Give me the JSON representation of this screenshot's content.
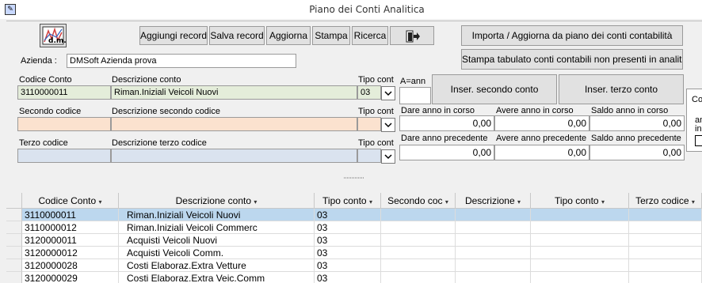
{
  "window": {
    "title": "Piano dei Conti Analitica"
  },
  "toolbar": {
    "add_record": "Aggiungi record",
    "save_record": "Salva record",
    "refresh": "Aggiorna",
    "print": "Stampa",
    "search": "Ricerca",
    "import": "Importa / Aggiorna da piano dei conti contabilità",
    "print_missing": "Stampa tabulato conti contabili non presenti in analitica",
    "logo_text": "d.m."
  },
  "company": {
    "label": "Azienda :",
    "value": "DMSoft Azienda prova"
  },
  "account": {
    "code_label": "Codice Conto",
    "desc_label": "Descrizione conto",
    "type_label": "Tipo cont",
    "code_value": "3110000011",
    "desc_value": "Riman.Iniziali Veicoli Nuovi",
    "type_value": "03"
  },
  "second": {
    "code_label": "Secondo codice",
    "desc_label": "Descrizione secondo codice",
    "type_label": "Tipo cont",
    "code_value": "",
    "desc_value": "",
    "type_value": ""
  },
  "third": {
    "code_label": "Terzo codice",
    "desc_label": "Descrizione terzo codice",
    "type_label": "Tipo cont",
    "code_value": "",
    "desc_value": "",
    "type_value": ""
  },
  "year": {
    "label": "A=ann",
    "value": ""
  },
  "insert": {
    "second": "Inser. secondo conto",
    "third": "Inser. terzo conto"
  },
  "totals": {
    "dare_cur_label": "Dare anno in corso",
    "avere_cur_label": "Avere anno in corso",
    "saldo_cur_label": "Saldo anno in corso",
    "dare_prev_label": "Dare anno precedente",
    "avere_prev_label": "Avere anno precedente",
    "saldo_prev_label": "Saldo anno precedente",
    "dare_cur": "0,00",
    "avere_cur": "0,00",
    "saldo_cur": "0,00",
    "dare_prev": "0,00",
    "avere_prev": "0,00",
    "saldo_prev": "0,00"
  },
  "side_panel": {
    "title": "Co",
    "line1": "an",
    "line2": "in"
  },
  "table": {
    "columns": [
      "Codice Conto",
      "Descrizione conto",
      "Tipo conto",
      "Secondo coc",
      "Descrizione",
      "Tipo conto",
      "Terzo codice"
    ],
    "rows": [
      [
        "3110000011",
        "Riman.Iniziali Veicoli Nuovi",
        "03",
        "",
        "",
        "",
        ""
      ],
      [
        "3110000012",
        "Riman.Iniziali Veicoli Commerc",
        "03",
        "",
        "",
        "",
        ""
      ],
      [
        "3120000011",
        "Acquisti  Veicoli Nuovi",
        "03",
        "",
        "",
        "",
        ""
      ],
      [
        "3120000012",
        "Acquisti  Veicoli Comm.",
        "03",
        "",
        "",
        "",
        ""
      ],
      [
        "3120000028",
        "Costi Elaboraz.Extra Vetture",
        "03",
        "",
        "",
        "",
        ""
      ],
      [
        "3120000029",
        "Costi Elaboraz.Extra Veic.Comm",
        "03",
        "",
        "",
        "",
        ""
      ]
    ]
  }
}
